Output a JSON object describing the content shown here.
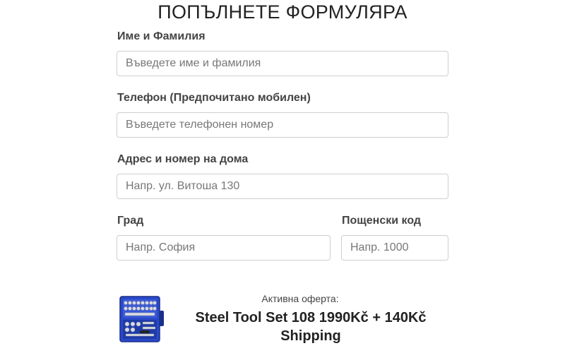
{
  "form": {
    "title": "ПОПЪЛНЕТЕ ФОРМУЛЯРА",
    "fields": {
      "name": {
        "label": "Име и Фамилия",
        "placeholder": "Въведете име и фамилия",
        "value": ""
      },
      "phone": {
        "label": "Телефон (Предпочитано мобилен)",
        "placeholder": "Въведете телефонен номер",
        "value": ""
      },
      "address": {
        "label": "Адрес и номер на дома",
        "placeholder": "Напр. ул. Витоша 130",
        "value": ""
      },
      "city": {
        "label": "Град",
        "placeholder": "Напр. София",
        "value": ""
      },
      "postal": {
        "label": "Пощенски код",
        "placeholder": "Напр. 1000",
        "value": ""
      }
    }
  },
  "offer": {
    "label": "Активна оферта:",
    "title": "Steel Tool Set 108 1990Kč + 140Kč Shipping",
    "image_icon": "tool-set-case-icon",
    "accent_color": "#2a49c8"
  }
}
